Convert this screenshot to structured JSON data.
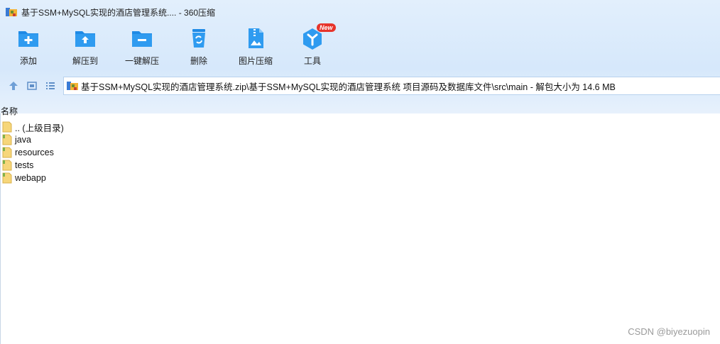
{
  "window": {
    "title": "基于SSM+MySQL实现的酒店管理系统.... - 360压缩"
  },
  "toolbar": {
    "items": [
      {
        "label": "添加",
        "icon": "add-icon"
      },
      {
        "label": "解压到",
        "icon": "extract-to-icon"
      },
      {
        "label": "一键解压",
        "icon": "one-click-extract-icon"
      },
      {
        "label": "删除",
        "icon": "delete-icon"
      },
      {
        "label": "图片压缩",
        "icon": "image-compress-icon"
      },
      {
        "label": "工具",
        "icon": "tools-icon",
        "badge": "New"
      }
    ]
  },
  "nav": {
    "path": "基于SSM+MySQL实现的酒店管理系统.zip\\基于SSM+MySQL实现的酒店管理系统 项目源码及数据库文件\\src\\main - 解包大小为 14.6 MB"
  },
  "list": {
    "column_name": "名称",
    "items": [
      {
        "name": ".. (上级目录)",
        "type": "parent"
      },
      {
        "name": "java",
        "type": "folder"
      },
      {
        "name": "resources",
        "type": "folder"
      },
      {
        "name": "tests",
        "type": "folder"
      },
      {
        "name": "webapp",
        "type": "folder"
      }
    ]
  },
  "watermark": "CSDN @biyezuopin",
  "colors": {
    "accent": "#2a8ef0",
    "chrome_bg": "#dceafb",
    "badge": "#e7342b",
    "folder": "#f6d67a"
  }
}
